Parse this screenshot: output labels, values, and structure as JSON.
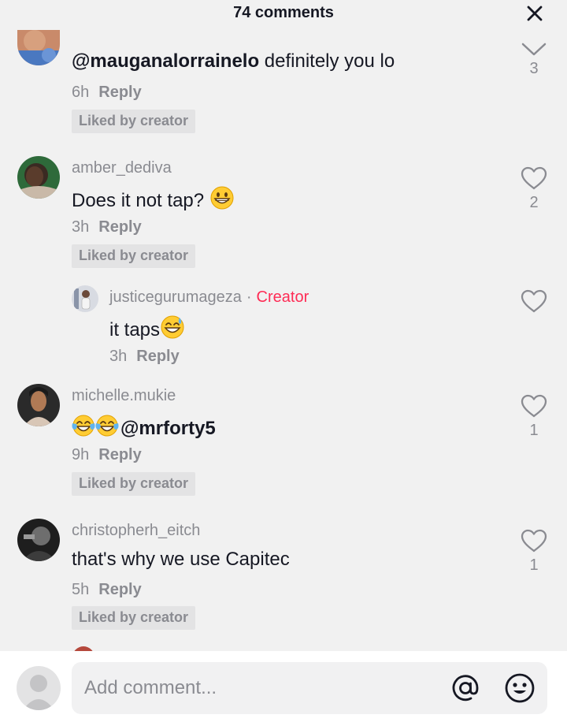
{
  "header": {
    "title": "74 comments",
    "close_icon": "close-icon"
  },
  "comments": [
    {
      "mention": "@mauganalorrainelo",
      "text": " definitely you lo",
      "time": "6h",
      "reply_label": "Reply",
      "badge": "Liked by creator",
      "likes": "3",
      "like_icon": "chevron-down-icon"
    },
    {
      "username": "amber_dediva",
      "text": "Does it not tap?",
      "emoji": "grinning-face",
      "time": "3h",
      "reply_label": "Reply",
      "badge": "Liked by creator",
      "likes": "2",
      "like_icon": "heart-outline-icon"
    },
    {
      "username": "justicegurumageza",
      "separator": "·",
      "creator_label": "Creator",
      "text": "it taps",
      "emoji": "grinning-face-with-sweat",
      "time": "3h",
      "reply_label": "Reply",
      "like_icon": "heart-outline-icon"
    },
    {
      "username": "michelle.mukie",
      "emoji": "face-with-tears-of-joy",
      "mention": "@mrforty5",
      "time": "9h",
      "reply_label": "Reply",
      "badge": "Liked by creator",
      "likes": "1",
      "like_icon": "heart-outline-icon"
    },
    {
      "username": "christopherh_eitch",
      "text": "that's why we use Capitec",
      "time": "5h",
      "reply_label": "Reply",
      "badge": "Liked by creator",
      "likes": "1",
      "like_icon": "heart-outline-icon"
    }
  ],
  "footer": {
    "placeholder": "Add comment...",
    "mention_icon": "at-sign-icon",
    "emoji_icon": "smiley-icon"
  },
  "colors": {
    "background": "#f1f1f1",
    "text": "#161823",
    "muted": "#8a8b91",
    "badge_bg": "#e3e3e4",
    "creator": "#fe2c55"
  }
}
